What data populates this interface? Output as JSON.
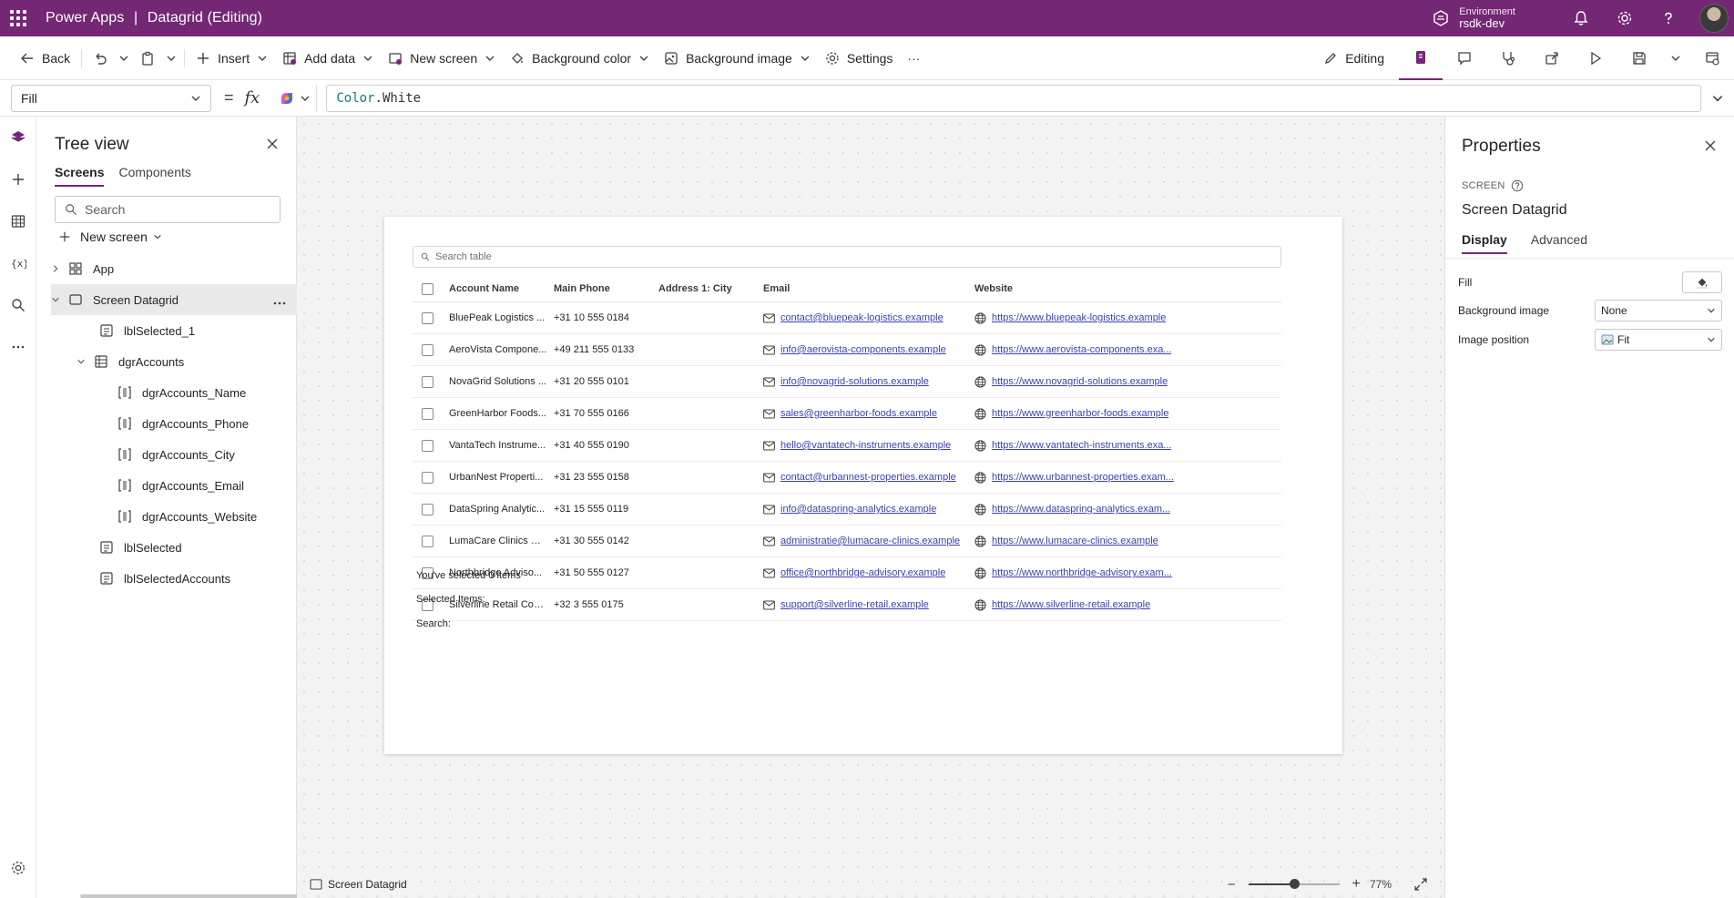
{
  "topbar": {
    "app_name": "Power Apps",
    "separator": "|",
    "doc_title": "Datagrid (Editing)",
    "env_label": "Environment",
    "env_name": "rsdk-dev",
    "brand_color": "#742774"
  },
  "commandbar": {
    "back": "Back",
    "insert": "Insert",
    "add_data": "Add data",
    "new_screen": "New screen",
    "background_color": "Background color",
    "background_image": "Background image",
    "settings": "Settings",
    "more": "···",
    "editing": "Editing"
  },
  "formula": {
    "property": "Fill",
    "equals": "=",
    "fx": "fx",
    "object": "Color",
    "dot": ".",
    "member": "White"
  },
  "tree": {
    "title": "Tree view",
    "tabs": [
      "Screens",
      "Components"
    ],
    "search_placeholder": "Search",
    "new_screen": "New screen",
    "nodes": {
      "app": "App",
      "screen": "Screen Datagrid",
      "lblSelected_1": "lblSelected_1",
      "dgrAccounts": "dgrAccounts",
      "col_name": "dgrAccounts_Name",
      "col_phone": "dgrAccounts_Phone",
      "col_city": "dgrAccounts_City",
      "col_email": "dgrAccounts_Email",
      "col_website": "dgrAccounts_Website",
      "lblSelected": "lblSelected",
      "lblSelectedAccounts": "lblSelectedAccounts"
    }
  },
  "datagrid": {
    "search_placeholder": "Search table",
    "columns": [
      "Account Name",
      "Main Phone",
      "Address 1: City",
      "Email",
      "Website"
    ],
    "rows": [
      {
        "name": "BluePeak Logistics ...",
        "phone": "+31 10 555 0184",
        "city": "",
        "email": "contact@bluepeak-logistics.example",
        "website": "https://www.bluepeak-logistics.example"
      },
      {
        "name": "AeroVista Compone...",
        "phone": "+49 211 555 0133",
        "city": "",
        "email": "info@aerovista-components.example",
        "website": "https://www.aerovista-components.exa..."
      },
      {
        "name": "NovaGrid Solutions ...",
        "phone": "+31 20 555 0101",
        "city": "",
        "email": "info@novagrid-solutions.example",
        "website": "https://www.novagrid-solutions.example"
      },
      {
        "name": "GreenHarbor Foods...",
        "phone": "+31 70 555 0166",
        "city": "",
        "email": "sales@greenharbor-foods.example",
        "website": "https://www.greenharbor-foods.example"
      },
      {
        "name": "VantaTech Instrume...",
        "phone": "+31 40 555 0190",
        "city": "",
        "email": "hello@vantatech-instruments.example",
        "website": "https://www.vantatech-instruments.exa..."
      },
      {
        "name": "UrbanNest Properti...",
        "phone": "+31 23 555 0158",
        "city": "",
        "email": "contact@urbannest-properties.example",
        "website": "https://www.urbannest-properties.exam..."
      },
      {
        "name": "DataSpring Analytic...",
        "phone": "+31 15 555 0119",
        "city": "",
        "email": "info@dataspring-analytics.example",
        "website": "https://www.dataspring-analytics.exam..."
      },
      {
        "name": "LumaCare Clinics B.V.",
        "phone": "+31 30 555 0142",
        "city": "",
        "email": "administratie@lumacare-clinics.example",
        "website": "https://www.lumacare-clinics.example"
      },
      {
        "name": "Northbridge Adviso...",
        "phone": "+31 50 555 0127",
        "city": "",
        "email": "office@northbridge-advisory.example",
        "website": "https://www.northbridge-advisory.exam..."
      },
      {
        "name": "Silverline Retail Con...",
        "phone": "+32 3 555 0175",
        "city": "",
        "email": "support@silverline-retail.example",
        "website": "https://www.silverline-retail.example"
      }
    ]
  },
  "labels": {
    "selected_count": "You've selected 0 items",
    "selected_items": "Selected Items:",
    "search": "Search:"
  },
  "canvas_footer": {
    "screen_name": "Screen Datagrid",
    "zoom_minus": "−",
    "zoom_plus": "+",
    "zoom_pct": "77%",
    "zoom_fraction": 0.5
  },
  "properties": {
    "title": "Properties",
    "kind": "SCREEN",
    "name": "Screen Datagrid",
    "tabs": [
      "Display",
      "Advanced"
    ],
    "fill_label": "Fill",
    "bg_image_label": "Background image",
    "bg_image_value": "None",
    "img_pos_label": "Image position",
    "img_pos_value": "Fit"
  }
}
